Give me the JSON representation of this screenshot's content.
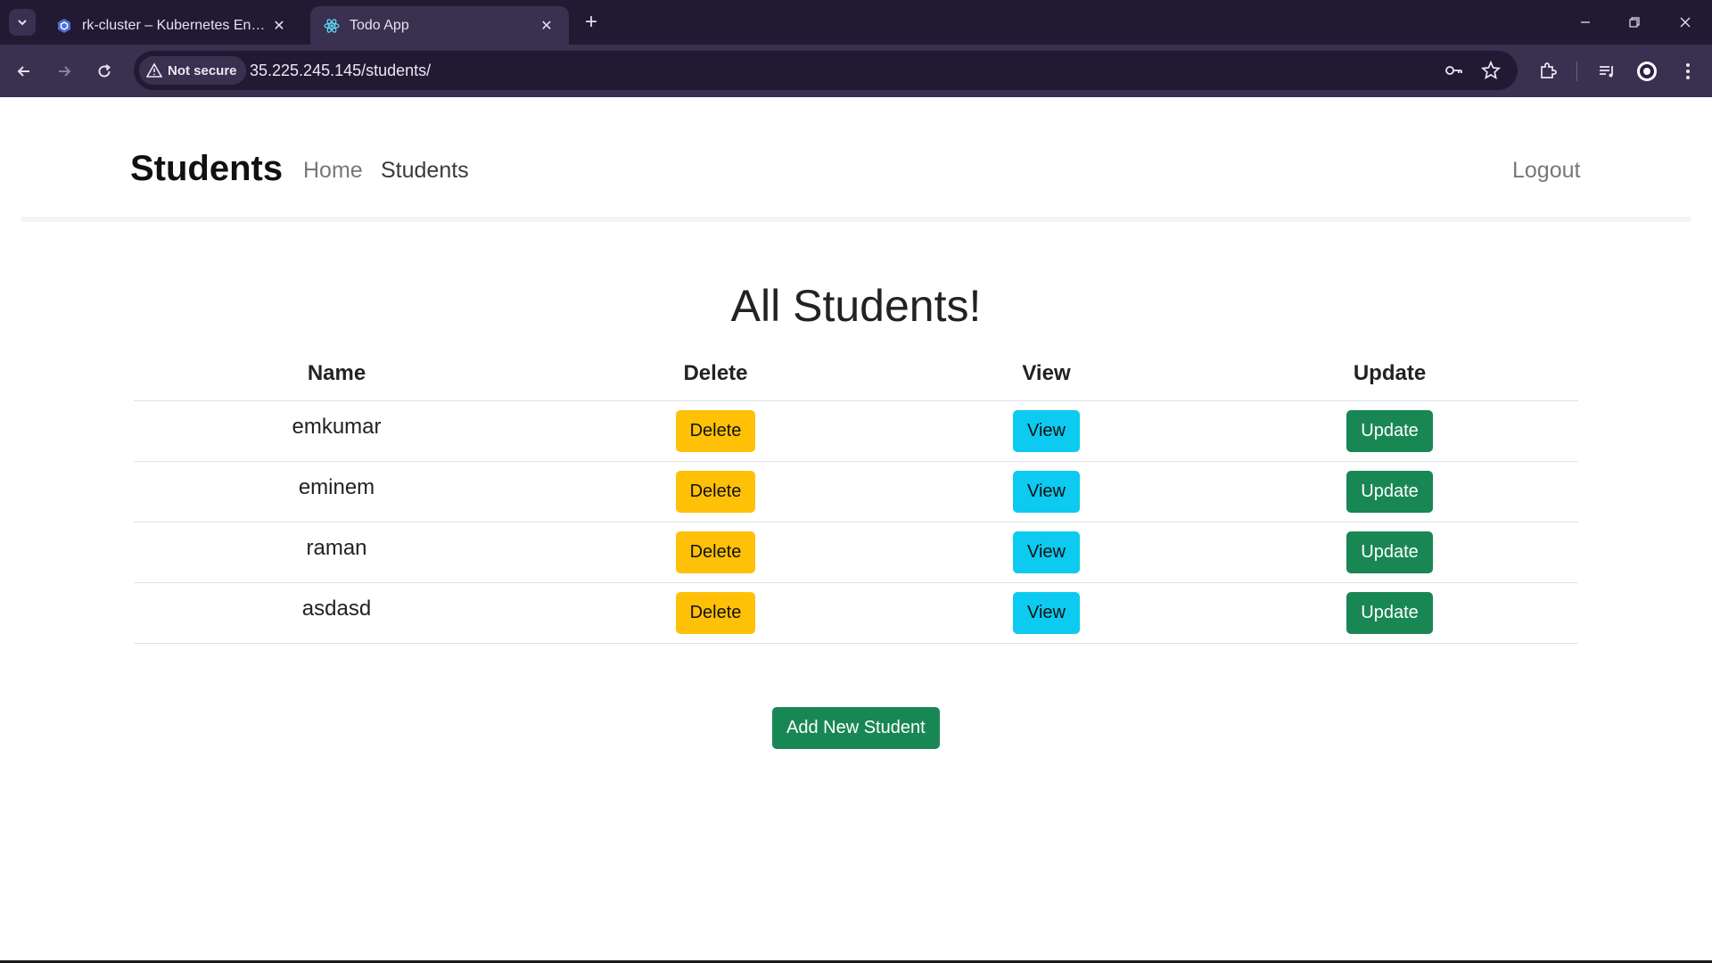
{
  "browser": {
    "tabs": [
      {
        "title": "rk-cluster – Kubernetes Engine – ",
        "icon": "kubernetes-engine-icon",
        "active": false
      },
      {
        "title": "Todo App",
        "icon": "react-icon",
        "active": true
      }
    ],
    "security_label": "Not secure",
    "url": "35.225.245.145/students/"
  },
  "navbar": {
    "brand": "Students",
    "links": [
      "Home",
      "Students"
    ],
    "logout": "Logout"
  },
  "main": {
    "heading": "All Students!",
    "columns": [
      "Name",
      "Delete",
      "View",
      "Update"
    ],
    "rows": [
      {
        "name": "emkumar",
        "delete": "Delete",
        "view": "View",
        "update": "Update"
      },
      {
        "name": "eminem",
        "delete": "Delete",
        "view": "View",
        "update": "Update"
      },
      {
        "name": "raman",
        "delete": "Delete",
        "view": "View",
        "update": "Update"
      },
      {
        "name": "asdasd",
        "delete": "Delete",
        "view": "View",
        "update": "Update"
      }
    ],
    "add_button": "Add New Student"
  },
  "colors": {
    "delete_button": "#ffc107",
    "view_button": "#0dcaf0",
    "update_button": "#198754",
    "chrome_dark": "#221a33",
    "chrome_toolbar": "#3a3050"
  }
}
